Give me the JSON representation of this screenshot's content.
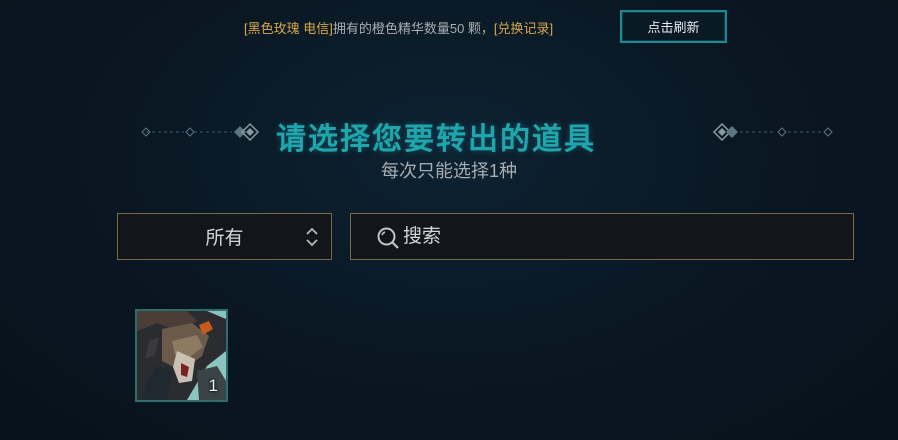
{
  "top_bar": {
    "account_name": "[黑色玫瑰 电信]",
    "essence_text": "拥有的橙色精华数量50 颗，",
    "history_link": "[兑换记录]",
    "refresh_label": "点击刷新"
  },
  "heading": {
    "title": "请选择您要转出的道具",
    "subtitle": "每次只能选择1种"
  },
  "filter": {
    "selected": "所有",
    "search_placeholder": "搜索"
  },
  "items": [
    {
      "count": "1"
    }
  ],
  "colors": {
    "accent_teal": "#1fa6ad",
    "gold": "#d8a64a",
    "border_gold": "#7a6a45"
  }
}
